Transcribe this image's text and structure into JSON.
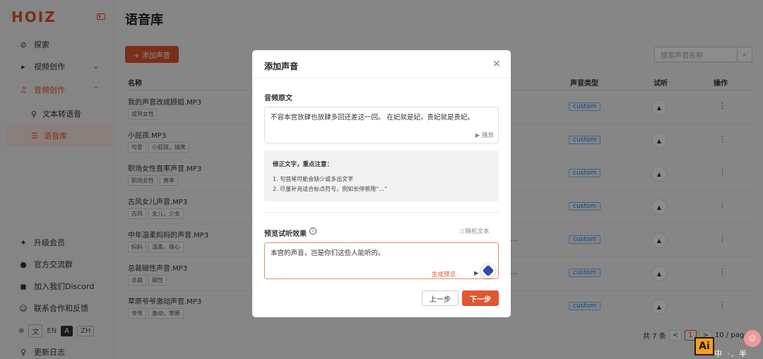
{
  "app": {
    "logo": "HOIZ"
  },
  "sidebar": {
    "items": [
      {
        "icon": "⊘",
        "label": "探索"
      },
      {
        "icon": "▸",
        "label": "视频创作",
        "chevron": "⌄"
      },
      {
        "icon": "♫",
        "label": "音频创作",
        "chevron": "⌃"
      }
    ],
    "sub_items": [
      {
        "icon": "♀",
        "label": "文本转语音"
      },
      {
        "icon": "☰",
        "label": "语音库"
      }
    ],
    "bottom_items": [
      {
        "icon": "✦",
        "label": "升级会员"
      },
      {
        "icon": "●",
        "label": "官方交流群"
      },
      {
        "icon": "◼",
        "label": "加入我们Discord"
      },
      {
        "icon": "☺",
        "label": "联系合作和反馈"
      },
      {
        "icon": "♀",
        "label": "更新日志"
      }
    ],
    "lang": {
      "globe": "⊕",
      "en": "EN",
      "zh": "ZH"
    }
  },
  "main": {
    "title": "语音库",
    "add_button": "+ 添加声音",
    "search_placeholder": "搜索声音名称",
    "search_icon": "search-icon",
    "columns": {
      "name": "名称",
      "type": "声音类型",
      "listen": "试听",
      "action": "操作"
    },
    "rows": [
      {
        "name": "我的声音改成顾姐.MP3",
        "tags": [
          "成熟女性"
        ],
        "type": "custom"
      },
      {
        "name": "小屁孩.MP3",
        "tags": [
          "可爱",
          "小屁孩，搞笑"
        ],
        "type": "custom"
      },
      {
        "name": "职场女性直率声音.MP3",
        "tags": [
          "职场女性",
          "直率"
        ],
        "type": "custom"
      },
      {
        "name": "古风女儿声音.MP3",
        "tags": [
          "古风",
          "女儿，少女"
        ],
        "type": "custom"
      },
      {
        "name": "中年温柔妈妈的声音.MP3",
        "tags": [
          "妈妈",
          "温柔，操心"
        ],
        "type": "custom"
      },
      {
        "name": "总裁磁性声音.MP3",
        "tags": [
          "总裁",
          "磁性"
        ],
        "type": "custom"
      },
      {
        "name": "草原爷爷激动声音.MP3",
        "tags": [
          "爷爷",
          "激动，草原"
        ],
        "type": "custom"
      }
    ],
    "listen_icon": "▲",
    "more_icon": "⋮",
    "ellipsis": "...",
    "pager": {
      "total": "共 7 条",
      "prev": "<",
      "page": "1",
      "next": ">",
      "size": "10 / page"
    }
  },
  "modal": {
    "title": "添加声音",
    "close": "✕",
    "original_label": "音频原文",
    "original_text": "不容本宫放肆也放肆多回还差这一回。 在妃就是妃，贵妃就是贵妃。",
    "play": "▶  播放",
    "tips_title": "修正文字，重点注意：",
    "tips": [
      "1. 句首尾可能会缺少或多出文字",
      "2. 尽量补充适合标点符号，例如长停顿用“...”"
    ],
    "preview_label": "预览试听效果",
    "info": "i",
    "random": "⤨  随机文本",
    "preview_text": "本宫的声音，岂是你们这些人能听的。",
    "generate": "生成预览",
    "gen_play": "▶",
    "prev_button": "上一步",
    "next_button": "下一步"
  },
  "widgets": {
    "ai_badge": "Ai",
    "ime": "中 ·, 半",
    "bubble": "☺"
  },
  "colors": {
    "accent": "#e0572f",
    "badge_blue": "#2b7fd6"
  }
}
